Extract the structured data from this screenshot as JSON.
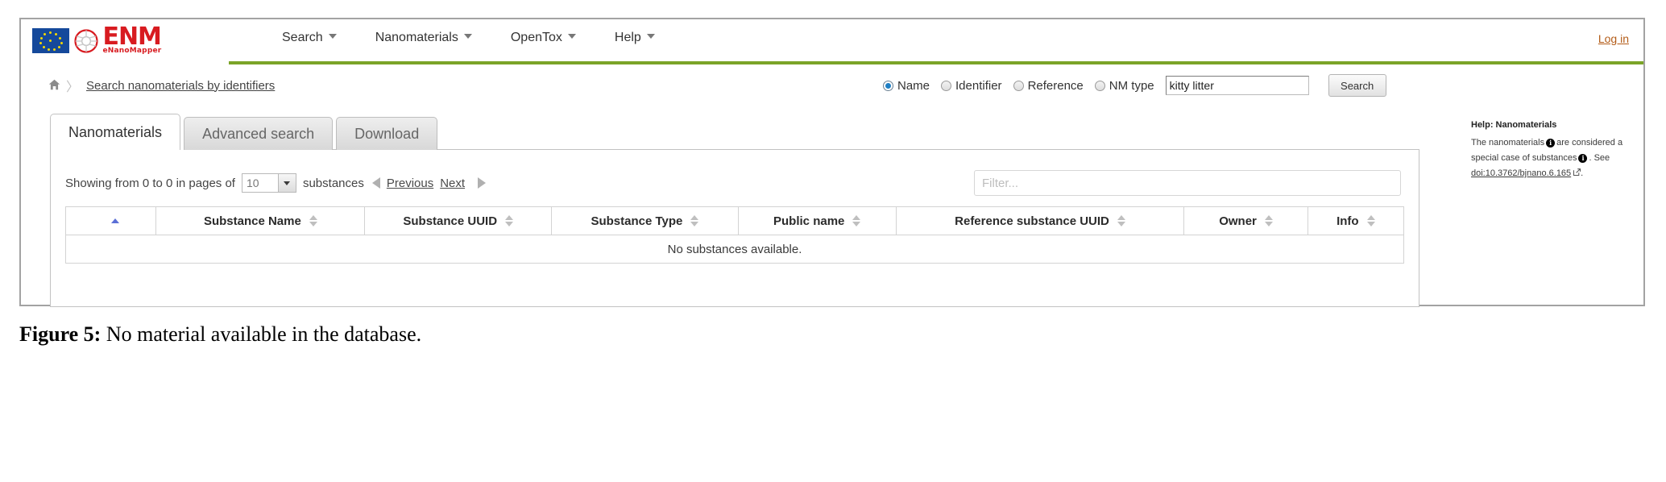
{
  "header": {
    "logo": {
      "eu_flag": "eu-flag-icon",
      "buckyball": "buckyball-icon",
      "brand_text": "ENM",
      "brand_subtext": "eNanoMapper"
    },
    "nav": [
      {
        "label": "Search",
        "caret": "chevron-down-icon"
      },
      {
        "label": "Nanomaterials",
        "caret": "chevron-down-icon"
      },
      {
        "label": "OpenTox",
        "caret": "chevron-down-icon"
      },
      {
        "label": "Help",
        "caret": "chevron-down-icon"
      }
    ],
    "login_label": "Log in",
    "accent_rule_color": "#7ba428"
  },
  "breadcrumb": {
    "home_icon": "home-icon",
    "separator": "〉",
    "link_label": "Search nanomaterials by identifiers"
  },
  "search": {
    "options": [
      {
        "label": "Name",
        "checked": true
      },
      {
        "label": "Identifier",
        "checked": false
      },
      {
        "label": "Reference",
        "checked": false
      },
      {
        "label": "NM type",
        "checked": false
      }
    ],
    "query_value": "kitty litter",
    "query_placeholder": "",
    "button_label": "Search"
  },
  "tabs": [
    {
      "label": "Nanomaterials",
      "active": true
    },
    {
      "label": "Advanced search",
      "active": false
    },
    {
      "label": "Download",
      "active": false
    }
  ],
  "toolbar": {
    "showing_prefix": "Showing from 0 to 0 in pages of",
    "page_size_value": "10",
    "showing_suffix": "substances",
    "prev_label": "Previous",
    "next_label": "Next",
    "prev_arrow": "triangle-left-icon",
    "next_arrow": "triangle-right-icon",
    "filter_placeholder": "Filter...",
    "filter_value": ""
  },
  "table": {
    "columns": [
      {
        "label": "",
        "sort": "asc"
      },
      {
        "label": "Substance Name",
        "sort": "none"
      },
      {
        "label": "Substance UUID",
        "sort": "none"
      },
      {
        "label": "Substance Type",
        "sort": "none"
      },
      {
        "label": "Public name",
        "sort": "none"
      },
      {
        "label": "Reference substance UUID",
        "sort": "none"
      },
      {
        "label": "Owner",
        "sort": "none"
      },
      {
        "label": "Info",
        "sort": "none"
      }
    ],
    "empty_message": "No substances available.",
    "rows": []
  },
  "help": {
    "title": "Help: Nanomaterials",
    "line1_a": "The nanomaterials",
    "line1_b": "are",
    "line2": "considered a special case of",
    "line3_a": "substances",
    "line3_b": ". See",
    "doi_label": "doi:10.3762/bjnano.6.165",
    "doi_suffix": ".",
    "info_icon": "info-icon",
    "external_icon": "external-link-icon"
  },
  "caption": {
    "label": "Figure 5:",
    "text": " No material available in the database."
  }
}
